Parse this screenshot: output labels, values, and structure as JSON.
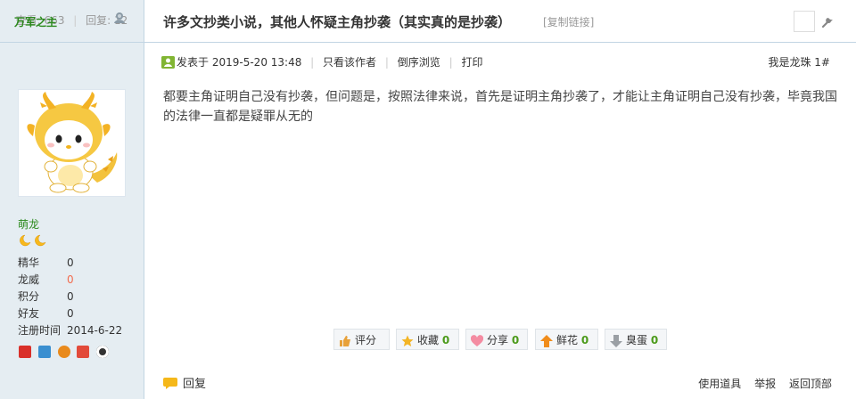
{
  "stats": {
    "views_label": "查看:",
    "views": "663",
    "replies_label": "回复:",
    "replies": "12"
  },
  "author": {
    "name": "万军之主",
    "group": "萌龙"
  },
  "profile": [
    {
      "key": "精华",
      "value": "0",
      "highlight": false
    },
    {
      "key": "龙威",
      "value": "0",
      "highlight": true
    },
    {
      "key": "积分",
      "value": "0",
      "highlight": false
    },
    {
      "key": "好友",
      "value": "0",
      "highlight": false
    },
    {
      "key": "注册时间",
      "value": "2014-6-22",
      "highlight": false
    }
  ],
  "thread": {
    "title": "许多文抄类小说，其他人怀疑主角抄袭（其实真的是抄袭）",
    "copy_link": "[复制链接]"
  },
  "meta": {
    "posted_label": "发表于",
    "date": "2019-5-20 13:48",
    "only_author": "只看该作者",
    "reverse": "倒序浏览",
    "print": "打印",
    "floor_name": "我是龙珠",
    "floor_num": "1#"
  },
  "content": "都要主角证明自己没有抄袭，但问题是，按照法律来说，首先是证明主角抄袭了，才能让主角证明自己没有抄袭，毕竟我国的法律一直都是疑罪从无的",
  "actions": {
    "rate": "评分",
    "fav": "收藏",
    "fav_count": "0",
    "share": "分享",
    "share_count": "0",
    "flower": "鲜花",
    "flower_count": "0",
    "egg": "臭蛋",
    "egg_count": "0"
  },
  "bottom": {
    "reply": "回复",
    "tools": "使用道具",
    "report": "举报",
    "top": "返回顶部"
  },
  "colors": {
    "sidebar_bg": "#e5edf2",
    "border": "#c2d5e3",
    "author": "#2c8a1e",
    "count": "#4b9a1a",
    "red": "#f26c4f"
  }
}
